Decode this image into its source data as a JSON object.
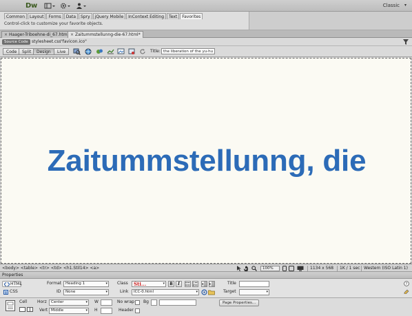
{
  "app": {
    "logo": "Dw",
    "workspace": "Classic"
  },
  "insert_panel": {
    "tabs": [
      "Common",
      "Layout",
      "Forms",
      "Data",
      "Spry",
      "jQuery Mobile",
      "InContext Editing",
      "Text",
      "Favorites"
    ],
    "active_tab": "Favorites",
    "hint": "Control-click to customize your favorite objects."
  },
  "document_tabs": [
    {
      "label": "Haager-Triboehne-di_67.html",
      "active": false
    },
    {
      "label": "Zaitummstellunng-die-67.html*",
      "active": true
    }
  ],
  "related_files": {
    "source": "Source Code",
    "files": [
      "stylesheet.css",
      "\"favicon.ico\""
    ]
  },
  "doc_toolbar": {
    "views": [
      "Code",
      "Split",
      "Design",
      "Live"
    ],
    "active_view": "Design",
    "title_label": "Title:",
    "title_value": "the liberation of the yu-hu-m"
  },
  "canvas": {
    "heading": "Zaitummstellunng, die"
  },
  "status_bar": {
    "tag_selector": "<body> <table> <tr> <td> <h1.Stil14> <a>",
    "zoom": "100%",
    "window_size": "1134 x 568",
    "download": "1K / 1 sec",
    "encoding": "Western (ISO Latin 1)"
  },
  "properties": {
    "title": "Properties",
    "html_label": "HTML",
    "css_label": "CSS",
    "format_label": "Format",
    "format_value": "Heading 1",
    "id_label": "ID",
    "id_value": "None",
    "class_label": "Class",
    "class_value": "Sti...",
    "link_label": "Link",
    "link_value": "ICC-0.html",
    "title_label": "Title",
    "title_value": "",
    "target_label": "Target",
    "target_value": "",
    "bold_label": "B",
    "italic_label": "I",
    "cell_label": "Cell",
    "horz_label": "Horz",
    "horz_value": "Center",
    "vert_label": "Vert",
    "vert_value": "Middle",
    "w_label": "W",
    "h_label": "H",
    "nowrap_label": "No wrap",
    "header_label": "Header",
    "bg_label": "Bg",
    "page_props_label": "Page Properties..."
  },
  "colors": {
    "heading": "#2c6bb7",
    "canvas_bg": "#fbfaf3",
    "class_text": "#cc2222"
  }
}
